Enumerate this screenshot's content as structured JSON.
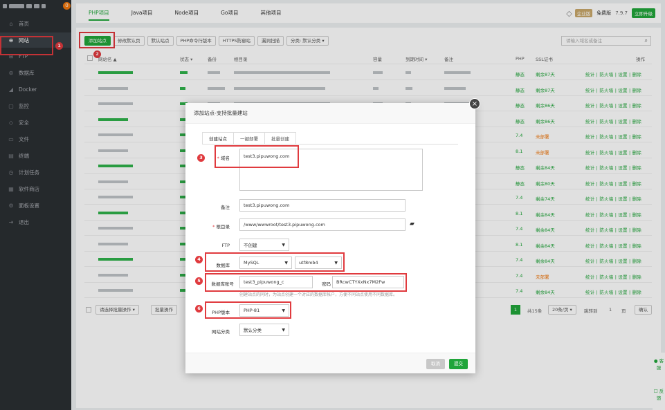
{
  "sidebar": {
    "badge": "0",
    "items": [
      {
        "label": "首页",
        "icon": "home-icon"
      },
      {
        "label": "网站",
        "icon": "globe-icon"
      },
      {
        "label": "FTP",
        "icon": "ftp-icon"
      },
      {
        "label": "数据库",
        "icon": "database-icon"
      },
      {
        "label": "Docker",
        "icon": "docker-icon"
      },
      {
        "label": "监控",
        "icon": "monitor-icon"
      },
      {
        "label": "安全",
        "icon": "shield-icon"
      },
      {
        "label": "文件",
        "icon": "folder-icon"
      },
      {
        "label": "终端",
        "icon": "terminal-icon"
      },
      {
        "label": "计划任务",
        "icon": "clock-icon"
      },
      {
        "label": "软件商店",
        "icon": "grid-icon"
      },
      {
        "label": "面板设置",
        "icon": "gear-icon"
      },
      {
        "label": "退出",
        "icon": "logout-icon"
      }
    ]
  },
  "tabs": [
    "PHP项目",
    "Java项目",
    "Node项目",
    "Go项目",
    "其他项目"
  ],
  "header": {
    "enterprise": "企业版",
    "free": "免费版",
    "version": "7.9.7",
    "upgrade": "立即升级"
  },
  "toolbar": [
    "添加站点",
    "修改默认页",
    "默认站点",
    "PHP命令行版本",
    "HTTPS防窜站",
    "漏洞扫描",
    "分类: 默认分类"
  ],
  "search": {
    "placeholder": "请输入域名或备注"
  },
  "columns": [
    "网站名 ▲",
    "状态 ▾",
    "备份",
    "根目录",
    "容量",
    "到期时间 ▾",
    "备注",
    "PHP",
    "SSL证书",
    "操作"
  ],
  "rows": [
    {
      "php": "静态",
      "ssl": "剩余87天"
    },
    {
      "php": "静态",
      "ssl": "剩余87天"
    },
    {
      "php": "静态",
      "ssl": "剩余86天"
    },
    {
      "php": "静态",
      "ssl": "剩余86天"
    },
    {
      "php": "7.4",
      "ssl": "未部署"
    },
    {
      "php": "8.1",
      "ssl": "未部署"
    },
    {
      "php": "静态",
      "ssl": "剩余84天"
    },
    {
      "php": "静态",
      "ssl": "剩余80天"
    },
    {
      "php": "7.4",
      "ssl": "剩余74天"
    },
    {
      "php": "8.1",
      "ssl": "剩余84天"
    },
    {
      "php": "7.4",
      "ssl": "剩余84天"
    },
    {
      "php": "8.1",
      "ssl": "剩余84天"
    },
    {
      "php": "7.4",
      "ssl": "剩余84天"
    },
    {
      "php": "7.4",
      "ssl": "未部署"
    },
    {
      "php": "7.4",
      "ssl": "剩余84天"
    }
  ],
  "row_ops": "统计 | 防火墙 | 设置 | 删除",
  "footer": {
    "batch_select": "请选择批量操作",
    "batch_btn": "批量操作",
    "page": "1",
    "total": "共15条",
    "per_page": "20条/页",
    "jump": "跳转到",
    "jump_page": "1",
    "page_unit": "页",
    "confirm": "确认"
  },
  "modal": {
    "title": "添加站点-支持批量建站",
    "tabs": [
      "创建站点",
      "一键部署",
      "批量创建"
    ],
    "domain_label": "域名",
    "domain_value": "test3.pipuwong.com",
    "note_label": "备注",
    "note_value": "test3.pipuwong.com",
    "root_label": "根目录",
    "root_value": "/www/wwwroot/test3.pipuwong.com",
    "ftp_label": "FTP",
    "ftp_value": "不创建",
    "db_label": "数据库",
    "db_value": "MySQL",
    "charset_value": "utf8mb4",
    "dbuser_label": "数据库账号",
    "dbuser_value": "test3_pipuwong_c",
    "pwd_label": "密码",
    "pwd_value": "BRcwCTYXxNx7M2Fw",
    "hint": "创建站点的同时，为站点创建一个对应的数据库帐户，方便不同站点使用不同数据库。",
    "php_label": "PHP版本",
    "php_value": "PHP-81",
    "cat_label": "网站分类",
    "cat_value": "默认分类",
    "cancel": "取消",
    "submit": "提交"
  },
  "annotations": [
    "1",
    "2",
    "3",
    "4",
    "5",
    "6"
  ],
  "rightbar": {
    "service": "客服",
    "feedback": "反馈"
  },
  "colors": {
    "accent": "#20a53a",
    "highlight": "#e03a3e",
    "sidebar": "#2b2f33"
  }
}
